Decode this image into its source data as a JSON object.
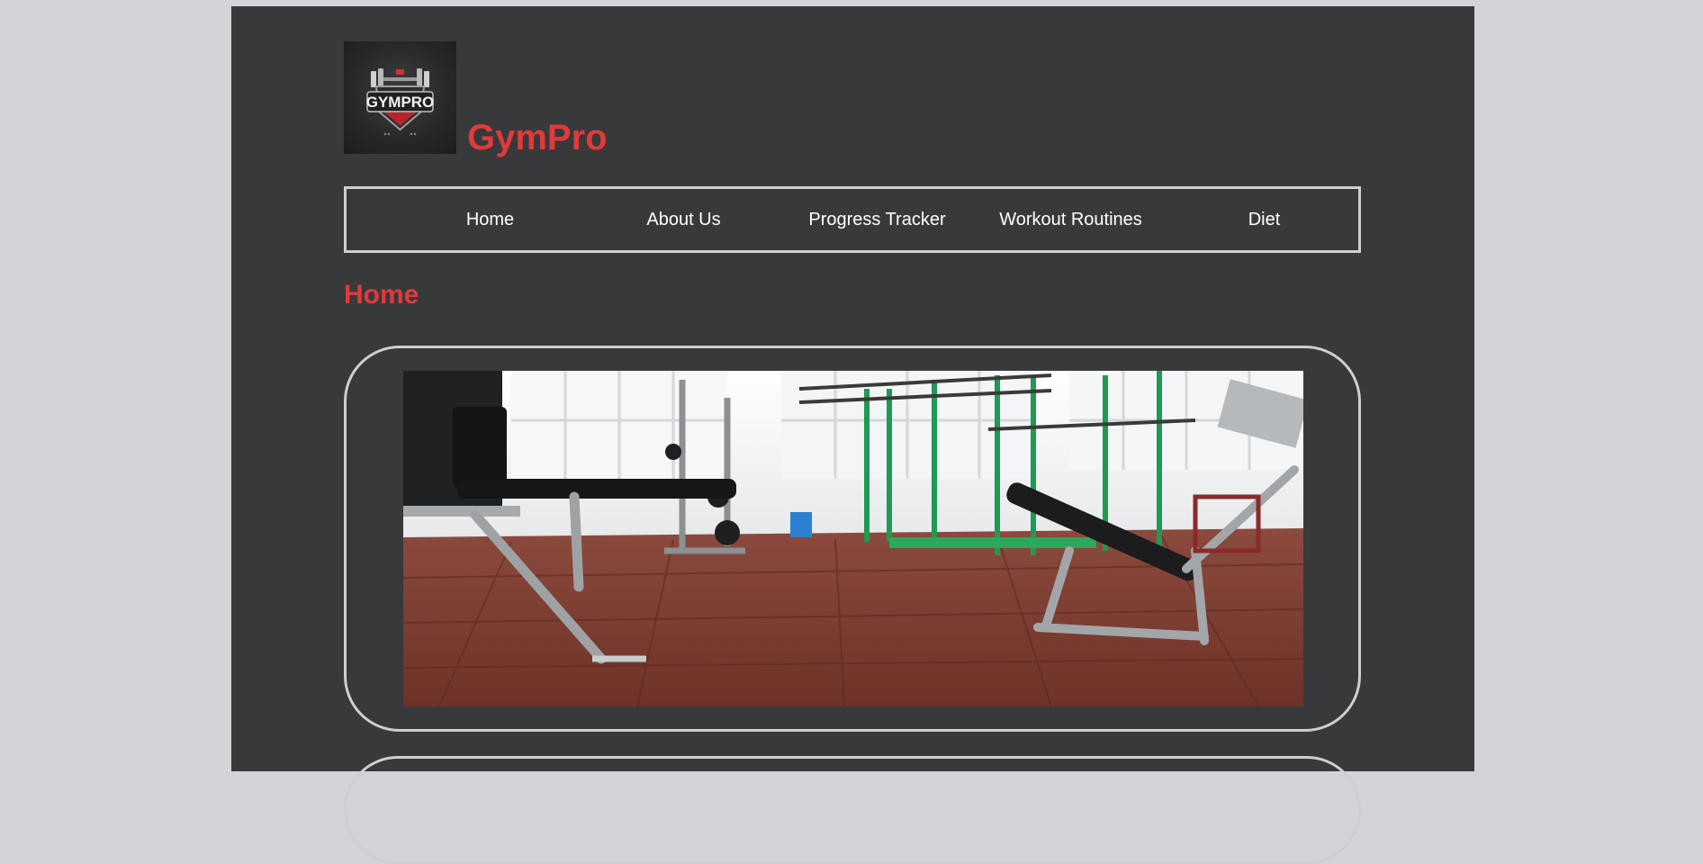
{
  "site": {
    "logo_text": "GYMPRO",
    "title": "GymPro"
  },
  "nav": {
    "items": [
      {
        "label": "Home"
      },
      {
        "label": "About Us"
      },
      {
        "label": "Progress Tracker"
      },
      {
        "label": "Workout Routines"
      },
      {
        "label": "Diet"
      }
    ]
  },
  "main": {
    "section_title": "Home"
  },
  "colors": {
    "page_background": "#d3d4d8",
    "content_background": "#38393b",
    "accent": "#e03a3a",
    "border": "#cfcfd2",
    "nav_text": "#ffffff"
  },
  "icons": {
    "logo": "gympro-dumbbell-shield-logo"
  }
}
